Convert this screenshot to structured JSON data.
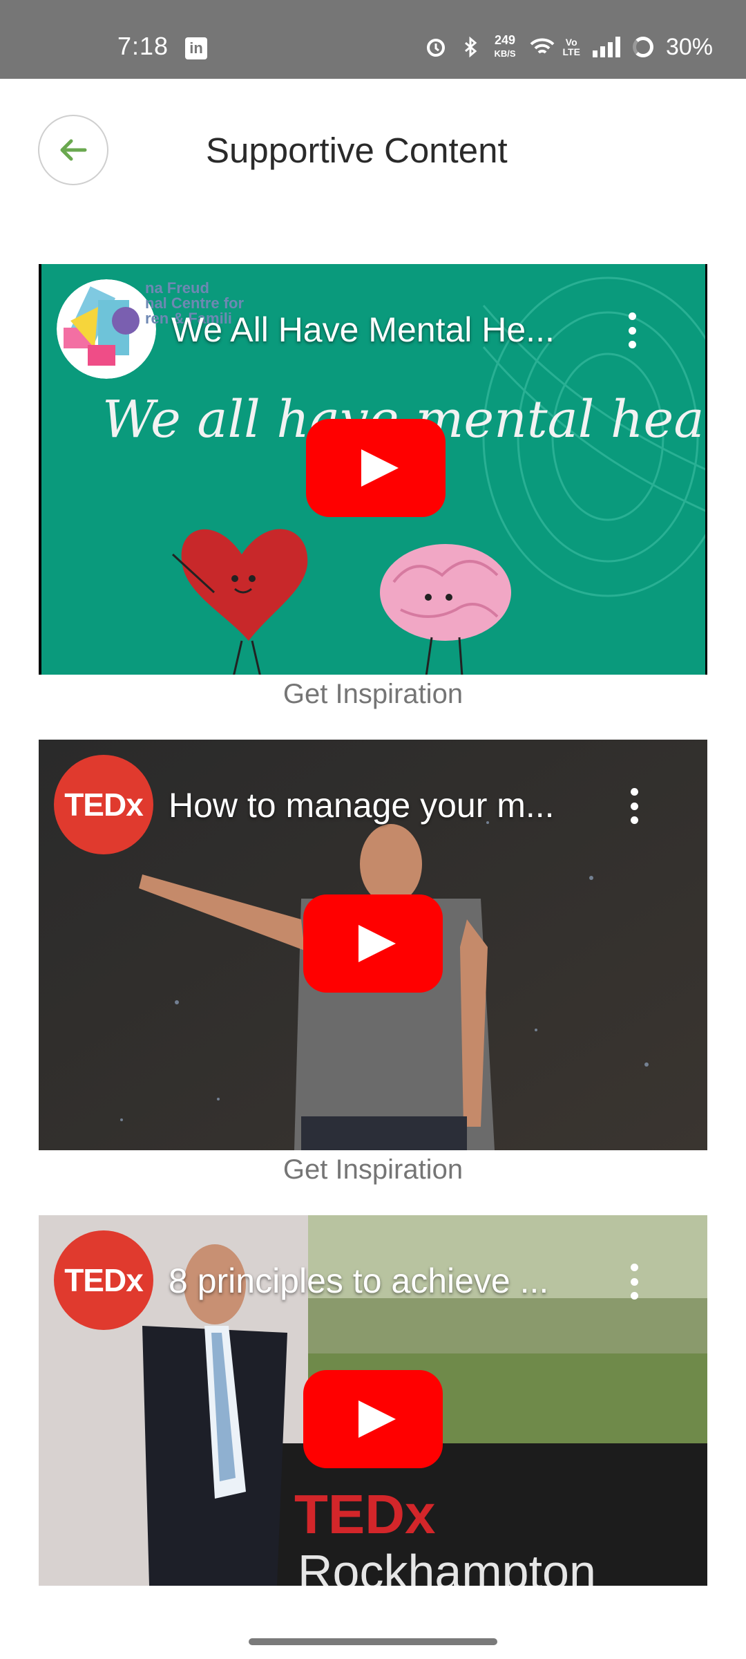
{
  "status_bar": {
    "time": "7:18",
    "linkedin_icon_text": "in",
    "speed_value": "249",
    "speed_unit": "KB/S",
    "volte": "Vo\nLTE",
    "battery": "30%"
  },
  "header": {
    "title": "Supportive Content"
  },
  "videos": [
    {
      "title": "We All Have Mental He...",
      "thumbnail_text": "We all have mental health",
      "channel_text": "na Freud\nnal Centre for\nren & Famili",
      "caption": "Get Inspiration"
    },
    {
      "title": "How to manage your m...",
      "channel_logo": "TEDx",
      "caption": "Get Inspiration"
    },
    {
      "title": "8 principles to achieve ...",
      "channel_logo": "TEDx",
      "stage_text_1": "TEDx",
      "stage_text_2": "Rockhampton"
    }
  ],
  "colors": {
    "status_bar": "#767676",
    "accent_green": "#6aa84f",
    "youtube_red": "#ff0000",
    "tedx_red": "#e03a2e",
    "card1_bg": "#0a9a7c"
  }
}
